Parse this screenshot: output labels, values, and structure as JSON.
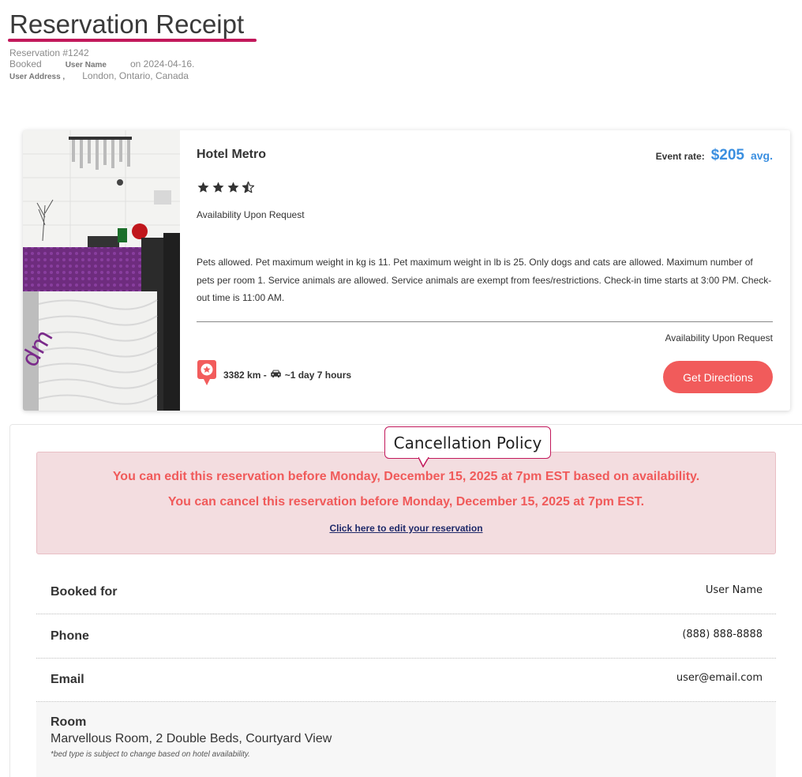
{
  "header": {
    "title": "Reservation Receipt",
    "reservation_number": "Reservation #1242",
    "booked_prefix": "Booked",
    "booked_user": "User Name",
    "booked_date": "on 2024-04-16.",
    "address_label": "User Address ,",
    "address_value": "London, Ontario, Canada"
  },
  "hotel": {
    "name": "Hotel Metro",
    "rate_label": "Event rate:",
    "rate_value": "$205",
    "rate_suffix": "avg.",
    "stars": 3.5,
    "availability_top": "Availability Upon Request",
    "policy": "Pets allowed. Pet maximum weight in kg is 11. Pet maximum weight in lb is 25. Only dogs and cats are allowed. Maximum number of pets per room 1. Service animals are allowed. Service animals are exempt from fees/restrictions. Check-in time starts at 3:00 PM. Check-out time is 11:00 AM.",
    "availability_bottom": "Availability Upon Request",
    "distance": "3382 km -",
    "drive_time": "~1 day 7 hours",
    "directions_button": "Get Directions",
    "accent_color": "#f15b5b",
    "rate_color": "#3b8fe0"
  },
  "cancellation": {
    "callout": "Cancellation Policy",
    "edit_notice": "You can edit this reservation before Monday, December 15, 2025 at 7pm EST based on availability.",
    "cancel_notice": "You can cancel this reservation before Monday, December 15, 2025 at 7pm EST.",
    "edit_link": "Click here to edit your reservation"
  },
  "details": {
    "booked_for_label": "Booked for",
    "booked_for_value": "User Name",
    "phone_label": "Phone",
    "phone_value": "(888) 888-8888",
    "email_label": "Email",
    "email_value": "user@email.com",
    "room_label": "Room",
    "room_value": "Marvellous Room, 2 Double Beds, Courtyard View",
    "room_note": "*bed type is subject to change based on hotel availability."
  }
}
